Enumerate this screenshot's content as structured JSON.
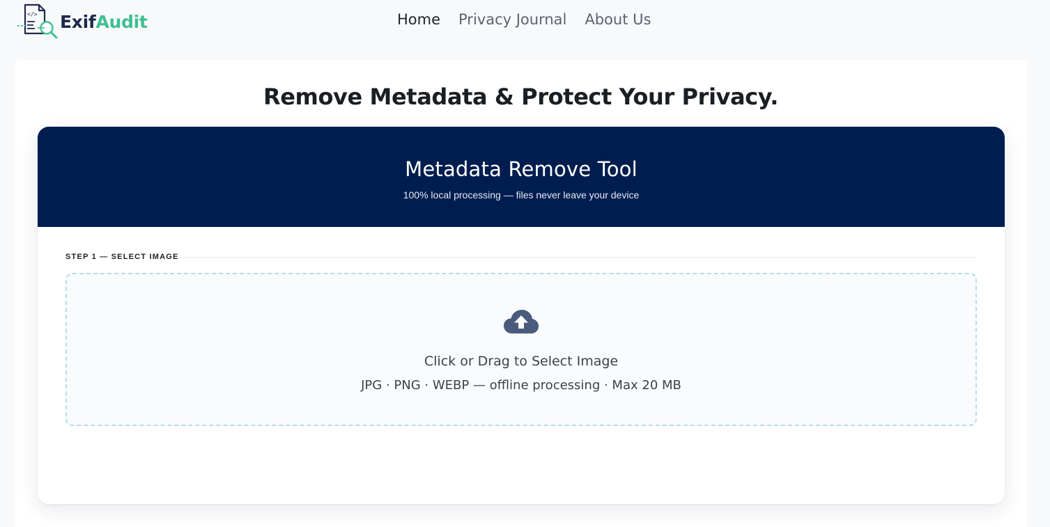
{
  "brand": {
    "name_part1": "Exif",
    "name_part2": "Audit",
    "accent": "#3fbf91",
    "dark": "#1e2a4a"
  },
  "nav": {
    "items": [
      {
        "label": "Home",
        "active": true
      },
      {
        "label": "Privacy Journal",
        "active": false
      },
      {
        "label": "About Us",
        "active": false
      }
    ]
  },
  "page": {
    "title": "Remove Metadata & Protect Your Privacy."
  },
  "tool": {
    "title": "Metadata Remove Tool",
    "subtitle": "100% local processing — files never leave your device",
    "header_color": "#001d4f",
    "step_label": "STEP 1 — SELECT IMAGE",
    "dropzone": {
      "icon": "cloud-upload-icon",
      "primary": "Click or Drag to Select Image",
      "secondary": "JPG · PNG · WEBP — offline processing · Max 20 MB"
    }
  }
}
